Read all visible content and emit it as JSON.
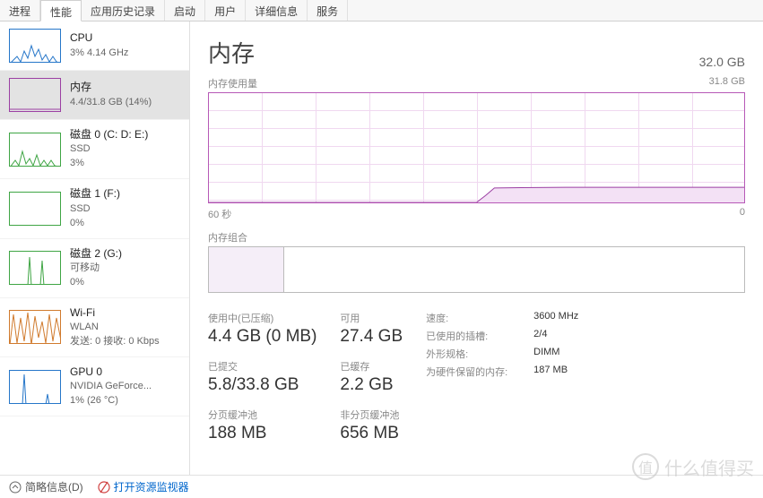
{
  "tabs": [
    "进程",
    "性能",
    "应用历史记录",
    "启动",
    "用户",
    "详细信息",
    "服务"
  ],
  "active_tab_index": 1,
  "sidebar": [
    {
      "title": "CPU",
      "sub1": "3% 4.14 GHz",
      "sub2": "",
      "color": "#2576c9"
    },
    {
      "title": "内存",
      "sub1": "4.4/31.8 GB (14%)",
      "sub2": "",
      "color": "#9b3fa3"
    },
    {
      "title": "磁盘 0 (C: D: E:)",
      "sub1": "SSD",
      "sub2": "3%",
      "color": "#3fa544"
    },
    {
      "title": "磁盘 1 (F:)",
      "sub1": "SSD",
      "sub2": "0%",
      "color": "#3fa544"
    },
    {
      "title": "磁盘 2 (G:)",
      "sub1": "可移动",
      "sub2": "0%",
      "color": "#3fa544"
    },
    {
      "title": "Wi-Fi",
      "sub1": "WLAN",
      "sub2": "发送: 0 接收: 0 Kbps",
      "color": "#d07a2d"
    },
    {
      "title": "GPU 0",
      "sub1": "NVIDIA GeForce...",
      "sub2": "1% (26 °C)",
      "color": "#2576c9"
    }
  ],
  "selected_sidebar_index": 1,
  "main": {
    "title": "内存",
    "capacity": "32.0 GB",
    "usage_graph": {
      "label": "内存使用量",
      "max": "31.8 GB",
      "x_left": "60 秒",
      "x_right": "0"
    },
    "composition": {
      "label": "内存组合"
    },
    "stats": {
      "inuse_label": "使用中(已压缩)",
      "inuse_value": "4.4 GB (0 MB)",
      "avail_label": "可用",
      "avail_value": "27.4 GB",
      "commit_label": "已提交",
      "commit_value": "5.8/33.8 GB",
      "cached_label": "已缓存",
      "cached_value": "2.2 GB",
      "paged_label": "分页缓冲池",
      "paged_value": "188 MB",
      "nonpaged_label": "非分页缓冲池",
      "nonpaged_value": "656 MB"
    },
    "meta": {
      "speed_label": "速度:",
      "speed_value": "3600 MHz",
      "slots_label": "已使用的插槽:",
      "slots_value": "2/4",
      "form_label": "外形规格:",
      "form_value": "DIMM",
      "reserved_label": "为硬件保留的内存:",
      "reserved_value": "187 MB"
    }
  },
  "footer": {
    "fewer": "简略信息(D)",
    "resmon": "打开资源监视器"
  },
  "watermark": "什么值得买",
  "chart_data": {
    "type": "line",
    "title": "内存使用量",
    "xlabel": "seconds ago",
    "ylabel": "GB",
    "ylim": [
      0,
      31.8
    ],
    "x": [
      60,
      55,
      50,
      45,
      40,
      35,
      30,
      29,
      28,
      25,
      20,
      15,
      10,
      5,
      0
    ],
    "values": [
      0,
      0,
      0,
      0,
      0,
      0,
      0,
      2.0,
      4.2,
      4.3,
      4.4,
      4.4,
      4.4,
      4.4,
      4.4
    ],
    "composition_percent_used": 14
  }
}
